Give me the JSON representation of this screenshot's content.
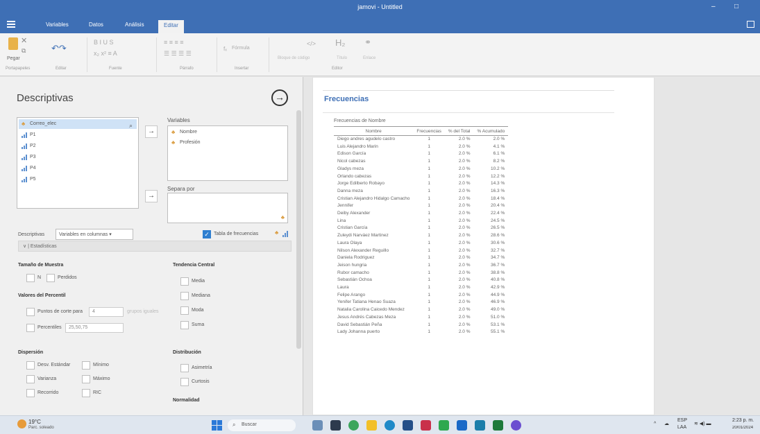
{
  "window": {
    "title": "jamovi - Untitled",
    "minimize": "–",
    "maximize": "□"
  },
  "menu": {
    "tabs": [
      "Variables",
      "Datos",
      "Análisis",
      "Editar"
    ],
    "active": "Editar"
  },
  "ribbon": {
    "clipboard": {
      "paste": "Pegar",
      "group": "Portapapeles"
    },
    "edit_group": "Editar",
    "font_group": "Fuente",
    "paragraph_group": "Párrafo",
    "insert": {
      "formula": "Fórmula",
      "group": "Insertar"
    },
    "code_block": "Bloque de código",
    "title": "Título",
    "link": "Enlace",
    "editor_group": "Editor"
  },
  "analysis": {
    "title": "Descriptivas",
    "variables": [
      {
        "name": "Correo_elec",
        "icon": "people-icon"
      },
      {
        "name": "P1",
        "icon": "bars-icon"
      },
      {
        "name": "P2",
        "icon": "bars-icon"
      },
      {
        "name": "P3",
        "icon": "bars-icon"
      },
      {
        "name": "P4",
        "icon": "bars-icon"
      },
      {
        "name": "P5",
        "icon": "bars-icon"
      }
    ],
    "variables_label": "Variables",
    "selected_vars": [
      "Nombre",
      "Profesión"
    ],
    "split_label": "Separa por",
    "descriptives_label": "Descriptivas",
    "layout_option": "Variables en columnas",
    "freq_table_label": "Tabla de frecuencias",
    "freq_table_checked": true,
    "stats_header": "Estadísticas",
    "sample_size": {
      "header": "Tamaño de Muestra",
      "n": "N",
      "missing": "Perdidos"
    },
    "percentile": {
      "header": "Valores del Percentil",
      "cut_points": "Puntos de corte para",
      "cut_value": "4",
      "equal_groups": "grupos iguales",
      "percentiles": "Percentiles",
      "percentile_values": "25,50,75"
    },
    "central": {
      "header": "Tendencia Central",
      "items": [
        "Media",
        "Mediana",
        "Moda",
        "Suma"
      ]
    },
    "dispersion": {
      "header": "Dispersión",
      "std": "Desv. Estándar",
      "min": "Mínimo",
      "var": "Varianza",
      "max": "Máximo",
      "range": "Recorrido",
      "iqr": "RIC"
    },
    "distribution": {
      "header": "Distribución",
      "skew": "Asimetría",
      "kurt": "Curtosis"
    },
    "normality_header": "Normalidad"
  },
  "results": {
    "heading": "Frecuencias",
    "table_title": "Frecuencias de Nombre",
    "columns": [
      "Nombre",
      "Frecuencias",
      "% del Total",
      "% Acumulado"
    ],
    "rows": [
      [
        "Diego andres agudelo castro",
        "1",
        "2.0 %",
        "2.0 %"
      ],
      [
        "Luis Alejandro Marin",
        "1",
        "2.0 %",
        "4.1 %"
      ],
      [
        "Edison García",
        "1",
        "2.0 %",
        "6.1 %"
      ],
      [
        "Nicol cabezas",
        "1",
        "2.0 %",
        "8.2 %"
      ],
      [
        "Gladys meza",
        "1",
        "2.0 %",
        "10.2 %"
      ],
      [
        "Orlando cabezas",
        "1",
        "2.0 %",
        "12.2 %"
      ],
      [
        "Jorge Edilberto Robayo",
        "1",
        "2.0 %",
        "14.3 %"
      ],
      [
        "Danna meza",
        "1",
        "2.0 %",
        "16.3 %"
      ],
      [
        "Cristian Alejandro Hidalgo Camacho",
        "1",
        "2.0 %",
        "18.4 %"
      ],
      [
        "Jennifer",
        "1",
        "2.0 %",
        "20.4 %"
      ],
      [
        "Deiby Alexander",
        "1",
        "2.0 %",
        "22.4 %"
      ],
      [
        "Lina",
        "1",
        "2.0 %",
        "24.5 %"
      ],
      [
        "Cristian García",
        "1",
        "2.0 %",
        "26.5 %"
      ],
      [
        "Zuleydi Narváez Martinez",
        "1",
        "2.0 %",
        "28.6 %"
      ],
      [
        "Laura Olaya",
        "1",
        "2.0 %",
        "30.6 %"
      ],
      [
        "Nilson Alexander Reguillo",
        "1",
        "2.0 %",
        "32.7 %"
      ],
      [
        "Daniela Rodriguez",
        "1",
        "2.0 %",
        "34.7 %"
      ],
      [
        "Jeison hungria",
        "1",
        "2.0 %",
        "36.7 %"
      ],
      [
        "Rubor camacho",
        "1",
        "2.0 %",
        "38.8 %"
      ],
      [
        "Sebastián Ochoa",
        "1",
        "2.0 %",
        "40.8 %"
      ],
      [
        "Laura",
        "1",
        "2.0 %",
        "42.9 %"
      ],
      [
        "Felipe Arango",
        "1",
        "2.0 %",
        "44.9 %"
      ],
      [
        "Yenifer Tatiana Henao Suaza",
        "1",
        "2.0 %",
        "46.9 %"
      ],
      [
        "Natalia Carolina Caicedo Mendez",
        "1",
        "2.0 %",
        "49.0 %"
      ],
      [
        "Jesus Andrés Cabezas Meza",
        "1",
        "2.0 %",
        "51.0 %"
      ],
      [
        "David Sebastián Peña",
        "1",
        "2.0 %",
        "53.1 %"
      ],
      [
        "Lady Johanna puerto",
        "1",
        "2.0 %",
        "55.1 %"
      ]
    ]
  },
  "taskbar": {
    "weather_temp": "19°C",
    "weather_desc": "Parc. soleado",
    "search": "Buscar",
    "lang": "ESP",
    "lang2": "LAA",
    "time": "2:23 p. m.",
    "date": "20/01/2024"
  },
  "colors": {
    "titlebar": "#3e6fb5",
    "accent": "#3e6fb5",
    "checkbox": "#2f7fd0"
  }
}
